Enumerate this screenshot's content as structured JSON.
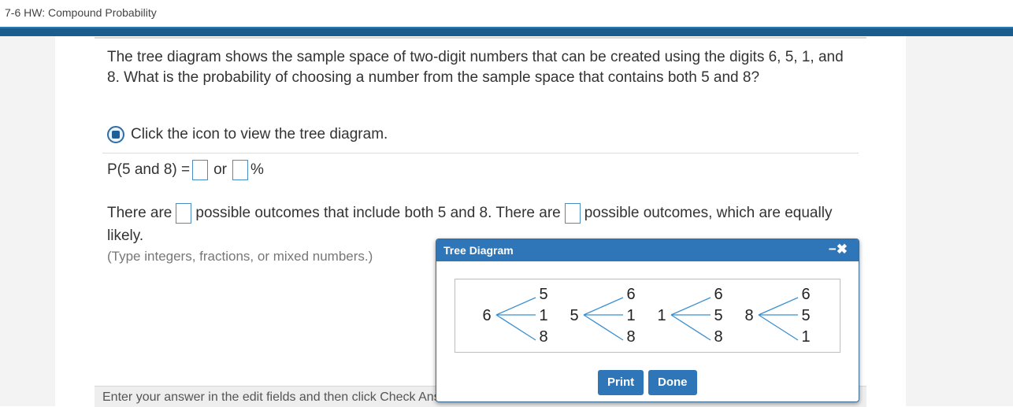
{
  "window": {
    "title": "7-6 HW: Compound Probability"
  },
  "question": {
    "text": "The tree diagram shows the sample space of two-digit numbers that can be created using the digits 6, 5, 1, and 8. What is the probability of choosing a number from the sample space that contains both 5 and 8?",
    "icon_prompt": "Click the icon to view the tree diagram."
  },
  "answer": {
    "prob_label": "P(5 and 8) =",
    "or_label": "or",
    "percent_label": "%",
    "outcomes_part1": "There are",
    "outcomes_part2": "possible outcomes that include both 5 and 8. There are",
    "outcomes_part3": "possible outcomes, which are equally likely.",
    "hint": "(Type integers, fractions, or mixed numbers.)"
  },
  "footer": {
    "text": "Enter your answer in the edit fields and then click Check Answer."
  },
  "dialog": {
    "title": "Tree Diagram",
    "close_label": "−✖",
    "print_label": "Print",
    "done_label": "Done",
    "trees": [
      {
        "root": "6",
        "branches": [
          "5",
          "1",
          "8"
        ]
      },
      {
        "root": "5",
        "branches": [
          "6",
          "1",
          "8"
        ]
      },
      {
        "root": "1",
        "branches": [
          "6",
          "5",
          "8"
        ]
      },
      {
        "root": "8",
        "branches": [
          "6",
          "5",
          "1"
        ]
      }
    ]
  },
  "colors": {
    "accent": "#2f76b8",
    "branch_line": "#3a8fcf",
    "nav_bar": "#1a5c8c"
  }
}
